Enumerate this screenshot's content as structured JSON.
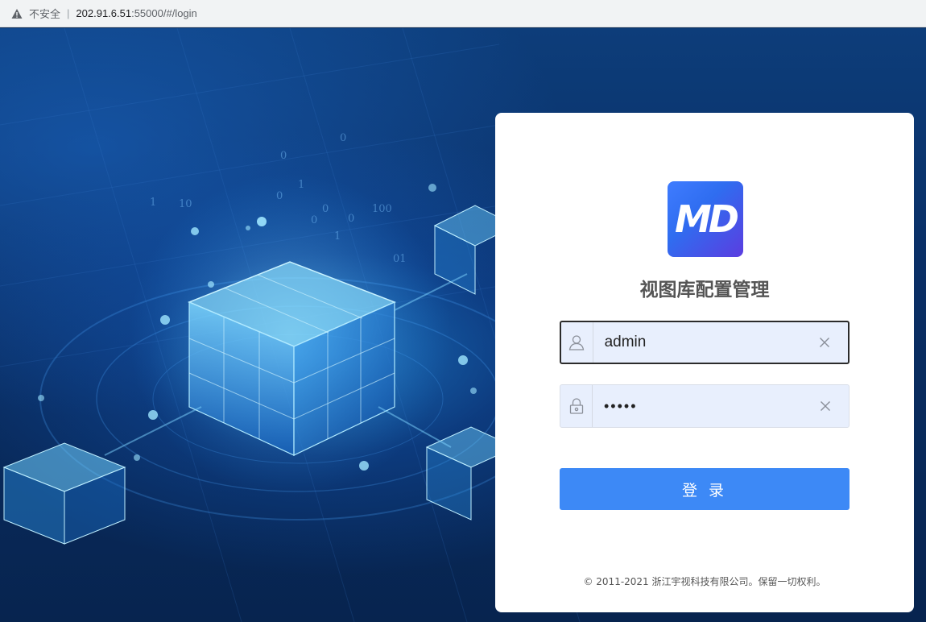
{
  "browser": {
    "security_text": "不安全",
    "url_host": "202.91.6.51",
    "url_path": ":55000/#/login"
  },
  "login": {
    "title": "视图库配置管理",
    "logo_text": "MD",
    "username_value": "admin",
    "password_value": "•••••",
    "submit_label": "登 录",
    "copyright": "© 2011-2021 浙江宇视科技有限公司。保留一切权利。"
  },
  "colors": {
    "accent": "#3d89f6",
    "input_bg": "#e8effd",
    "background": "#0a2f66"
  },
  "icons": {
    "security": "warning-icon",
    "username": "user-icon",
    "password": "lock-icon",
    "clear": "close-icon"
  }
}
